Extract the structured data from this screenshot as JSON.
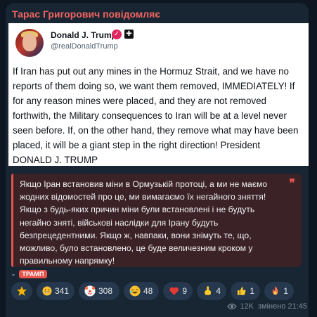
{
  "channel": {
    "sender": "Тарас Григорович повідомляє"
  },
  "tweet": {
    "author_name": "Donald J. Trump",
    "handle": "@realDonaldTrump",
    "text": "If Iran has put out any mines in the Hormuz Strait, and we have no reports of them doing so, we want them removed, IMMEDIATELY! If for any reason mines were placed, and they are not removed forthwith, the Military consequences to Iran will be at a level never seen before. If, on the other hand, they remove what may have been placed, it will be a giant step in the right direction! President DONALD J. TRUMP"
  },
  "quote": {
    "text": "Якщо Іран встановив міни в Ормузькій протоці, а ми не маємо жодних відомостей про це, ми вимагаємо їх негайного зняття! Якщо з будь-яких причин міни були встановлені і не будуть негайно зняті, військові наслідки для Ірану будуть безпрецедентними. Якщо ж, навпаки, вони знімуть те, що, можливо, було встановлено, це буде величезним кроком у правильному напрямку!"
  },
  "signature": {
    "prefix": "-",
    "tag": "ТРАМП"
  },
  "reactions": [
    {
      "icon": "star-icon",
      "count": ""
    },
    {
      "icon": "grin-icon",
      "count": "341"
    },
    {
      "icon": "clown-icon",
      "count": "308"
    },
    {
      "icon": "laugh-icon",
      "count": "48"
    },
    {
      "icon": "heart-icon",
      "count": "9"
    },
    {
      "icon": "middle-finger-icon",
      "count": "4"
    },
    {
      "icon": "thumbs-up-icon",
      "count": "1"
    },
    {
      "icon": "fire-icon",
      "count": "1"
    }
  ],
  "meta": {
    "views": "12K",
    "edited_time": "змінено 21:45"
  }
}
